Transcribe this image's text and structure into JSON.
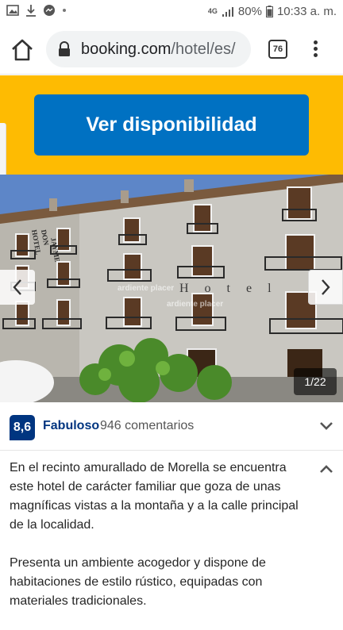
{
  "status_bar": {
    "network": "4G",
    "battery": "80%",
    "time": "10:33 a. m."
  },
  "browser": {
    "url_domain": "booking.com",
    "url_path": "/hotel/es/",
    "tab_count": "76"
  },
  "cta": {
    "label": "Ver disponibilidad",
    "band_color": "#febb02",
    "button_color": "#0071c2"
  },
  "gallery": {
    "counter": "1/22",
    "watermark_1": "ardiente placer",
    "watermark_2": "ardiente placer",
    "signage": "HOTEL DON JAYME",
    "facade_text": "Hotel"
  },
  "review": {
    "score": "8,6",
    "rating": "Fabuloso",
    "count": "946 comentarios",
    "badge_color": "#003580"
  },
  "description": {
    "paragraph_1": "En el recinto amurallado de Morella se encuentra este hotel de carácter familiar que goza de unas magníficas vistas a la montaña y a la calle principal de la localidad.",
    "paragraph_2": "Presenta un ambiente acogedor y dispone de habitaciones de estilo rústico, equipadas con materiales tradicionales."
  },
  "icons": [
    "image-icon",
    "download-icon",
    "messenger-icon",
    "signal-icon",
    "home-icon",
    "lock-icon",
    "menu-icon",
    "chevron-left-icon",
    "chevron-right-icon",
    "chevron-down-icon",
    "chevron-up-icon"
  ]
}
